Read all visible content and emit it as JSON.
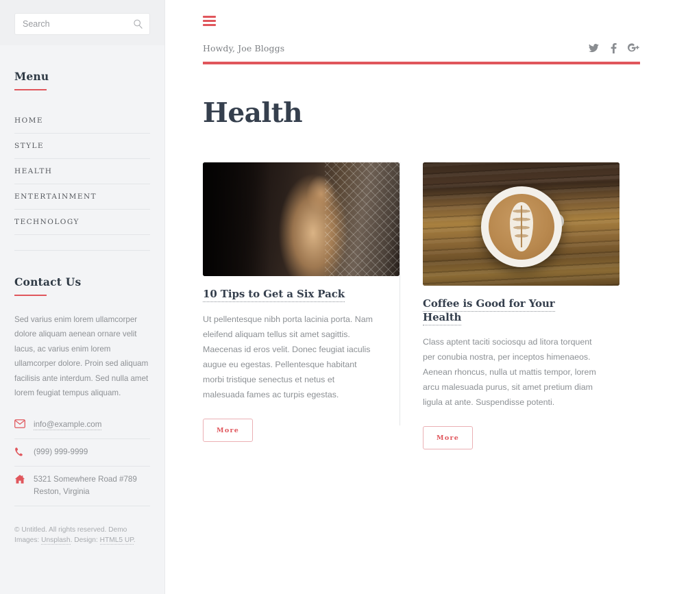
{
  "sidebar": {
    "search": {
      "placeholder": "Search",
      "value": "",
      "icon": "search-icon"
    },
    "menu": {
      "title": "Menu",
      "items": [
        {
          "label": "Home"
        },
        {
          "label": "Style"
        },
        {
          "label": "Health"
        },
        {
          "label": "Entertainment"
        },
        {
          "label": "Technology"
        }
      ]
    },
    "contact": {
      "title": "Contact Us",
      "blurb": "Sed varius enim lorem ullamcorper dolore aliquam aenean ornare velit lacus, ac varius enim lorem ullamcorper dolore. Proin sed aliquam facilisis ante interdum. Sed nulla amet lorem feugiat tempus aliquam.",
      "items": [
        {
          "icon": "envelope-icon",
          "text": "info@example.com",
          "is_link": true
        },
        {
          "icon": "phone-icon",
          "text": "(999) 999-9999",
          "is_link": false
        },
        {
          "icon": "home-icon",
          "text": "5321 Somewhere Road #789\nReston, Virginia",
          "is_link": false
        }
      ]
    },
    "footer": {
      "copyright_prefix": "© Untitled. All rights reserved. Demo Images:",
      "link1": "Unsplash",
      "mid": ". Design:",
      "link2": "HTML5 UP",
      "suffix": "."
    }
  },
  "header": {
    "menu_toggle": "hamburger-icon",
    "greeting": "Howdy, Joe Bloggs",
    "socials": [
      {
        "name": "twitter-icon",
        "glyph": "twitter"
      },
      {
        "name": "facebook-icon",
        "glyph": "facebook"
      },
      {
        "name": "google-plus-icon",
        "glyph": "googleplus"
      }
    ]
  },
  "main": {
    "page_title": "Health",
    "posts": [
      {
        "image_alt": "Shirtless athlete leaning on a punching bag in a gym",
        "title": "10 Tips to Get a Six Pack",
        "body": "Ut pellentesque nibh porta lacinia porta. Nam eleifend aliquam tellus sit amet sagittis. Maecenas id eros velit. Donec feugiat iaculis augue eu egestas. Pellentesque habitant morbi tristique senectus et netus et malesuada fames ac turpis egestas.",
        "more_label": "More"
      },
      {
        "image_alt": "Latte art in a white cup on a wooden table",
        "title": "Coffee is Good for Your Health",
        "body": "Class aptent taciti sociosqu ad litora torquent per conubia nostra, per inceptos himenaeos. Aenean rhoncus, nulla ut mattis tempor, lorem arcu malesuada purus, sit amet pretium diam ligula at ante. Suspendisse potenti.",
        "more_label": "More"
      }
    ]
  },
  "colors": {
    "accent": "#e0565c",
    "sidebar_bg": "#f3f4f6",
    "heading": "#353f4d",
    "body_text": "#8c9094"
  }
}
